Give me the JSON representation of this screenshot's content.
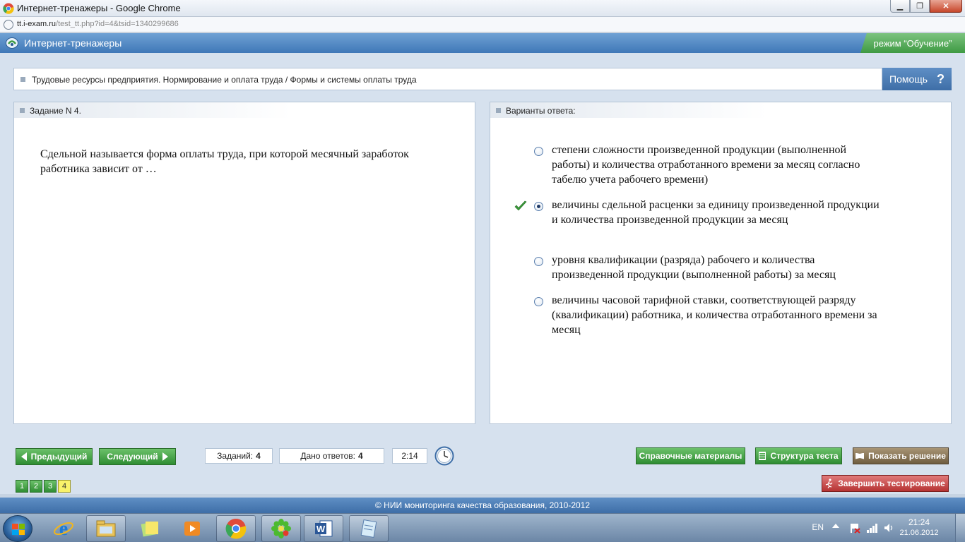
{
  "window": {
    "title": "Интернет-тренажеры - Google Chrome",
    "url_host": "tt.i-exam.ru",
    "url_path": "/test_tt.php?id=4&tsid=1340299686"
  },
  "app": {
    "title": "Интернет-тренажеры",
    "mode": "режим “Обучение”"
  },
  "breadcrumb": "Трудовые ресурсы предприятия. Нормирование и оплата труда / Формы и системы оплаты труда",
  "help_label": "Помощь",
  "help_glyph": "?",
  "task": {
    "header": "Задание N 4.",
    "question": "Сдельной называется форма оплаты труда, при которой месячный заработок работника зависит от …"
  },
  "answers": {
    "header": "Варианты ответа:",
    "options": [
      {
        "text": "степени сложности произведенной продукции (выполненной работы) и количества отработанного времени за месяц согласно табелю учета рабочего времени)",
        "selected": false,
        "correct": false
      },
      {
        "text": "величины сдельной расценки за единицу произведенной продукции и количества произведенной продукции за месяц",
        "selected": true,
        "correct": true
      },
      {
        "text": "уровня квалификации (разряда) рабочего и количества произведенной продукции (выполненной работы) за месяц",
        "selected": false,
        "correct": false
      },
      {
        "text": "величины часовой тарифной ставки, соответствующей разряду (квалификации) работника, и количества отработанного времени за месяц",
        "selected": false,
        "correct": false
      }
    ]
  },
  "toolbar": {
    "prev_label": "Предыдущий",
    "next_label": "Следующий",
    "tasks_label": "Заданий:",
    "tasks_value": "4",
    "answered_label": "Дано ответов:",
    "answered_value": "4",
    "timer": "2:14",
    "reference_label": "Справочные материалы",
    "structure_label": "Структура теста",
    "solution_label": "Показать решение",
    "finish_label": "Завершить тестирование"
  },
  "pages": [
    {
      "num": "1",
      "current": false
    },
    {
      "num": "2",
      "current": false
    },
    {
      "num": "3",
      "current": false
    },
    {
      "num": "4",
      "current": true
    }
  ],
  "footer": "© НИИ мониторинга качества образования, 2010-2012",
  "taskbar": {
    "lang": "EN",
    "time": "21:24",
    "date": "21.06.2012",
    "items": [
      "ie-icon",
      "explorer-icon",
      "sticky-notes-icon",
      "media-player-icon",
      "chrome-icon",
      "icq-icon",
      "word-icon",
      "notepad-icon"
    ]
  },
  "colors": {
    "accent_blue": "#3f78b8",
    "button_green": "#2f8d33",
    "button_red": "#b63333",
    "button_brown": "#6f5d40",
    "check_green": "#3a9a3a"
  }
}
